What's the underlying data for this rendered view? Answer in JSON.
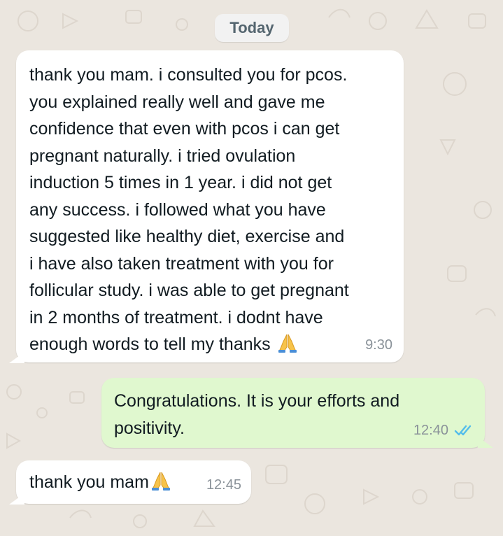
{
  "chat": {
    "date_label": "Today",
    "messages": [
      {
        "direction": "incoming",
        "text": "thank you mam. i consulted you for pcos.\nyou explained really well and gave me\nconfidence that even with pcos i can get\npregnant naturally. i tried ovulation\ninduction 5 times in 1 year. i did not get\nany success. i followed what you have\nsuggested like healthy diet, exercise and\ni have also taken treatment with you for\nfollicular study. i was able to get pregnant\nin 2 months of treatment. i dodnt have\nenough words to tell my thanks ",
        "emoji": "folded-hands-icon",
        "time": "9:30"
      },
      {
        "direction": "outgoing",
        "text": "Congratulations. It is your efforts and\npositivity.",
        "time": "12:40",
        "status": "read",
        "status_icon": "double-check-icon"
      },
      {
        "direction": "incoming",
        "text": "thank you mam",
        "emoji": "folded-hands-icon",
        "time": "12:45"
      }
    ]
  },
  "colors": {
    "wallpaper": "#ebe6df",
    "incoming_bubble": "#ffffff",
    "outgoing_bubble": "#e0f8cf",
    "read_ticks": "#53bdeb",
    "timestamp": "#8a9299"
  }
}
